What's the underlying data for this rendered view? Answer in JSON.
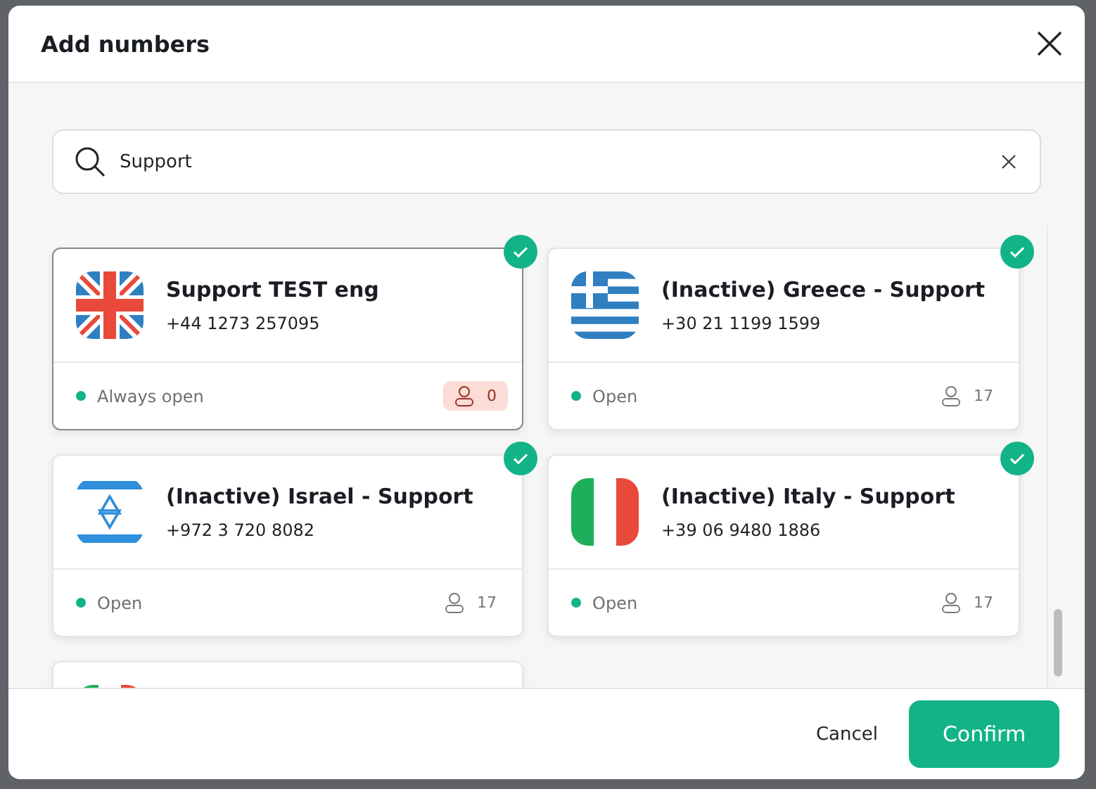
{
  "dialog": {
    "title": "Add numbers"
  },
  "search": {
    "value": "Support"
  },
  "cards": [
    {
      "kind": "uk",
      "name": "Support TEST eng",
      "number": "+44 1273 257095",
      "status": "Always open",
      "agents": "0",
      "alert": true,
      "selected": true,
      "hovered": true
    },
    {
      "kind": "greece",
      "name": "(Inactive) Greece - Support",
      "number": "+30 21 1199 1599",
      "status": "Open",
      "agents": "17",
      "alert": false,
      "selected": true,
      "hovered": false
    },
    {
      "kind": "israel",
      "name": "(Inactive) Israel - Support",
      "number": "+972 3 720 8082",
      "status": "Open",
      "agents": "17",
      "alert": false,
      "selected": true,
      "hovered": false
    },
    {
      "kind": "italy",
      "name": "(Inactive) Italy - Support",
      "number": "+39 06 9480 1886",
      "status": "Open",
      "agents": "17",
      "alert": false,
      "selected": true,
      "hovered": false
    },
    {
      "kind": "mexico",
      "selected": false,
      "hovered": false
    }
  ],
  "footer": {
    "cancel": "Cancel",
    "confirm": "Confirm"
  }
}
